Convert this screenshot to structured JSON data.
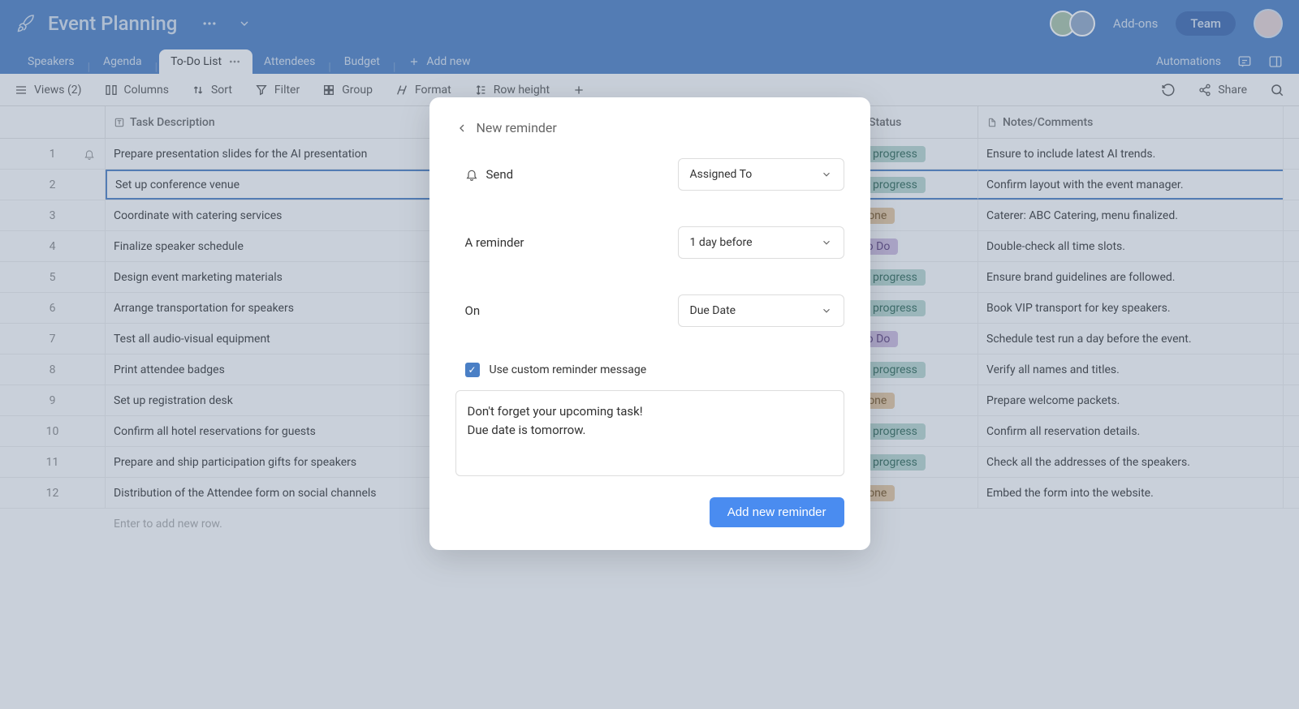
{
  "header": {
    "title": "Event Planning",
    "addons": "Add-ons",
    "team": "Team"
  },
  "tabs": {
    "items": [
      "Speakers",
      "Agenda",
      "To-Do List",
      "Attendees",
      "Budget"
    ],
    "active": 2,
    "add_new": "Add new",
    "automations": "Automations"
  },
  "toolbar": {
    "views": "Views (2)",
    "columns": "Columns",
    "sort": "Sort",
    "filter": "Filter",
    "group": "Group",
    "format": "Format",
    "row_height": "Row height",
    "share": "Share"
  },
  "columns": {
    "task": "Task Description",
    "status": "Status",
    "notes": "Notes/Comments"
  },
  "rows": [
    {
      "n": "1",
      "task": "Prepare presentation slides for the AI presentation",
      "status": "In progress",
      "status_kind": "progress",
      "notes": "Ensure to include latest AI trends.",
      "bell": true
    },
    {
      "n": "2",
      "task": "Set up conference venue",
      "status": "In progress",
      "status_kind": "progress",
      "notes": "Confirm layout with the event manager.",
      "selected": true
    },
    {
      "n": "3",
      "task": "Coordinate with catering services",
      "status": "Done",
      "status_kind": "done",
      "notes": "Caterer: ABC Catering, menu finalized."
    },
    {
      "n": "4",
      "task": "Finalize speaker schedule",
      "status": "To Do",
      "status_kind": "todo",
      "notes": "Double-check all time slots."
    },
    {
      "n": "5",
      "task": "Design event marketing materials",
      "status": "In progress",
      "status_kind": "progress",
      "notes": "Ensure brand guidelines are followed."
    },
    {
      "n": "6",
      "task": "Arrange transportation for speakers",
      "status": "In progress",
      "status_kind": "progress",
      "notes": "Book VIP transport for key speakers."
    },
    {
      "n": "7",
      "task": "Test all audio-visual equipment",
      "status": "To Do",
      "status_kind": "todo",
      "notes": "Schedule test run a day before the event."
    },
    {
      "n": "8",
      "task": "Print attendee badges",
      "status": "In progress",
      "status_kind": "progress",
      "notes": "Verify all names and titles."
    },
    {
      "n": "9",
      "task": "Set up registration desk",
      "status": "Done",
      "status_kind": "done",
      "notes": "Prepare welcome packets."
    },
    {
      "n": "10",
      "task": "Confirm all hotel reservations for guests",
      "status": "In progress",
      "status_kind": "progress",
      "notes": "Confirm all reservation details."
    },
    {
      "n": "11",
      "task": "Prepare and ship participation gifts for speakers",
      "status": "In progress",
      "status_kind": "progress",
      "notes": "Check all the addresses of the speakers."
    },
    {
      "n": "12",
      "task": "Distribution of the Attendee form on social channels",
      "status": "Done",
      "status_kind": "done",
      "notes": "Embed the form into the website."
    }
  ],
  "new_row_hint": "Enter to add new row.",
  "modal": {
    "title": "New reminder",
    "send_label": "Send",
    "send_value": "Assigned To",
    "reminder_label": "A reminder",
    "reminder_value": "1 day before",
    "on_label": "On",
    "on_value": "Due Date",
    "custom_msg_label": "Use custom reminder message",
    "custom_msg_checked": true,
    "message": "Don't forget your upcoming task!\nDue date is tomorrow.",
    "button": "Add new reminder"
  }
}
